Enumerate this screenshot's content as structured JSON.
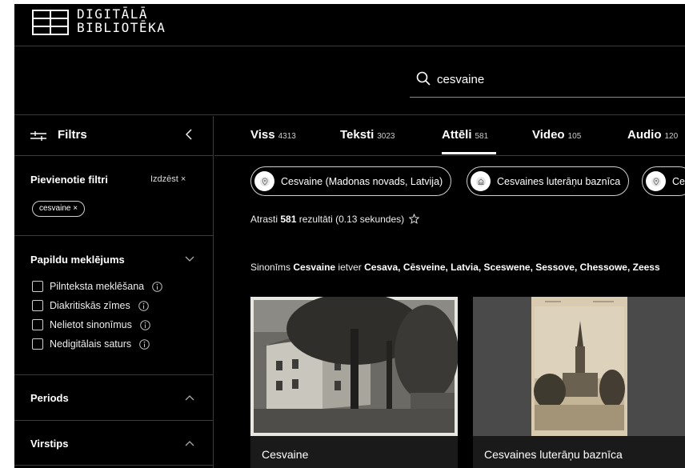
{
  "logo": {
    "line1": "DIGITĀLĀ",
    "line2": "BIBLIOTĒKA"
  },
  "search": {
    "value": "cesvaine",
    "icon": "search-icon"
  },
  "sidebar": {
    "title": "Filtrs",
    "applied": {
      "title": "Pievienotie filtri",
      "clear_label": "Izdzēst ×",
      "chip": "cesvaine ×"
    },
    "advanced": {
      "title": "Papildu meklējums",
      "options": [
        {
          "label": "Pilnteksta meklēšana"
        },
        {
          "label": "Diakritiskās zīmes"
        },
        {
          "label": "Nelietot sinonīmus"
        },
        {
          "label": "Nedigitālais saturs"
        }
      ]
    },
    "periods": {
      "title": "Periods"
    },
    "subtype": {
      "title": "Virstips"
    }
  },
  "tabs": [
    {
      "label": "Viss",
      "count": "4313"
    },
    {
      "label": "Teksti",
      "count": "3023"
    },
    {
      "label": "Attēli",
      "count": "581",
      "active": true
    },
    {
      "label": "Video",
      "count": "105"
    },
    {
      "label": "Audio",
      "count": "120"
    }
  ],
  "chips": [
    {
      "label": "Cesvaine (Madonas novads, Latvija)",
      "icon": "location-pin-icon"
    },
    {
      "label": "Cesvaines luterāņu baznīca",
      "icon": "church-icon"
    },
    {
      "label": "Ce",
      "icon": "location-pin-icon"
    }
  ],
  "results": {
    "prefix": "Atrasti",
    "count": "581",
    "suffix": "rezultāti (0.13 sekundes)"
  },
  "synonym": {
    "prefix": "Sinonīms",
    "term": "Cesvaine",
    "middle": "ietver",
    "list": "Cesava, Cēsveine, Latvia, Sceswene, Sessove, Chessowe, Zeess"
  },
  "cards": [
    {
      "caption": "Cesvaine"
    },
    {
      "caption": "Cesvaines luterāņu baznīca"
    }
  ],
  "colors": {
    "background": "#000000",
    "divider": "#3a3a3a",
    "text": "#ffffff"
  }
}
